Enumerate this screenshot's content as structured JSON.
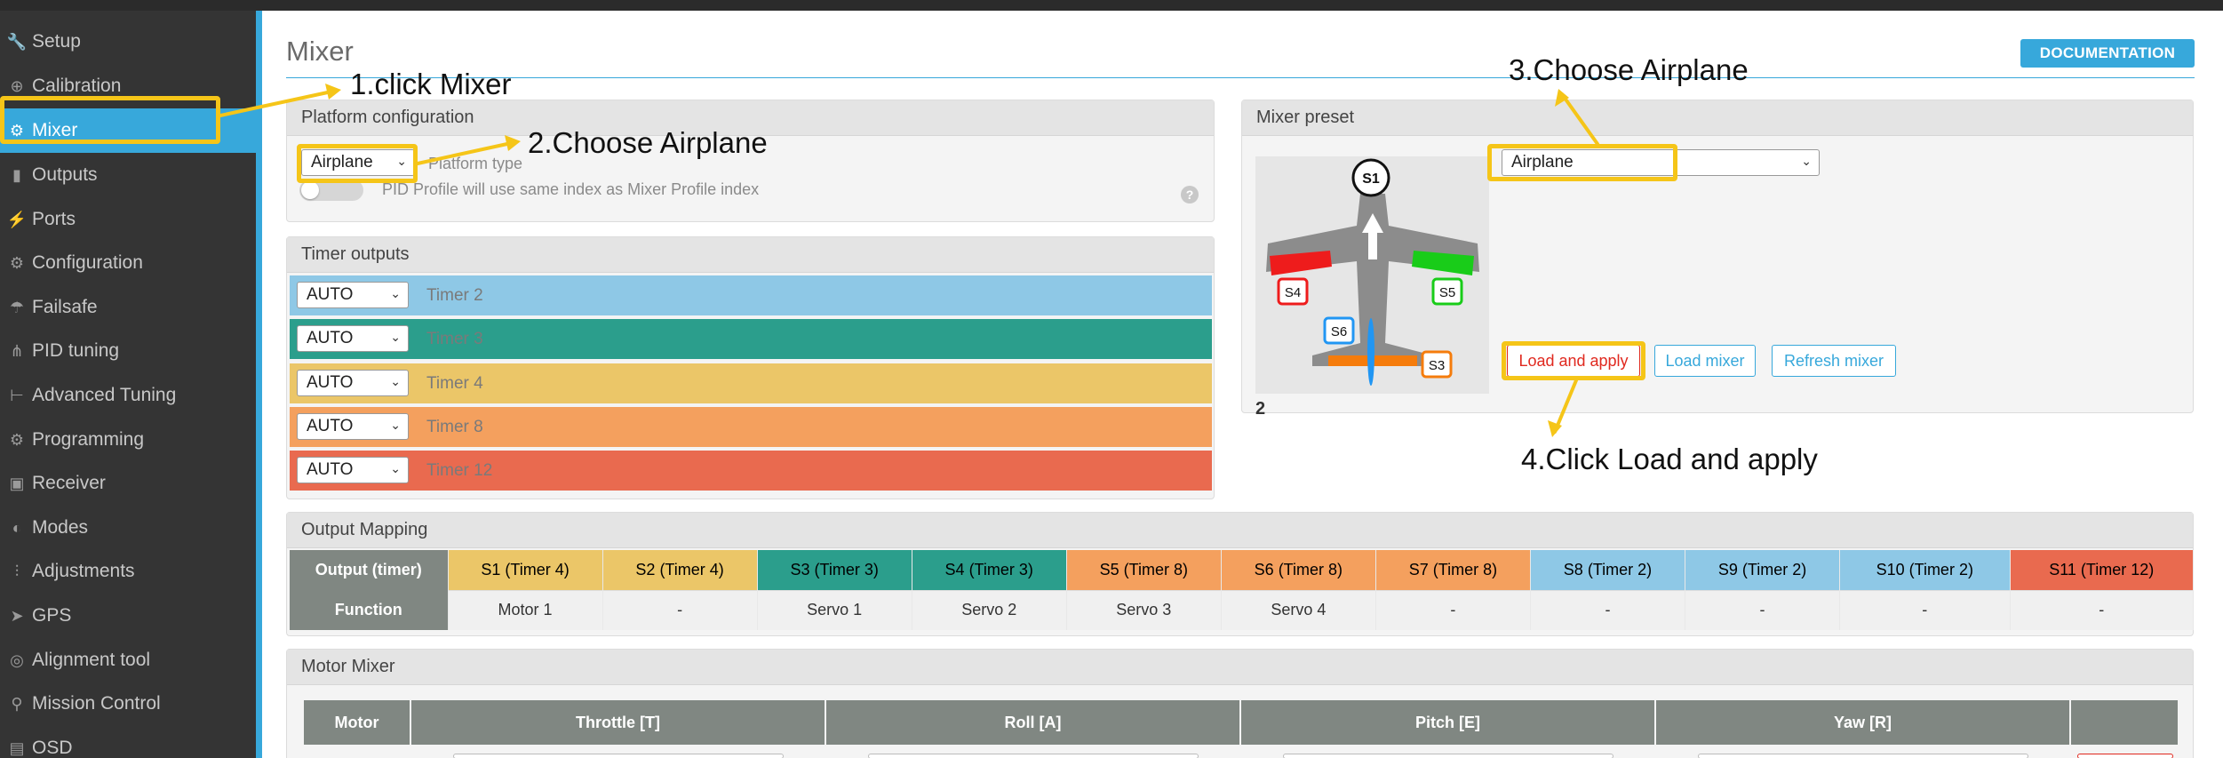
{
  "sidebar": {
    "items": [
      {
        "label": "Setup",
        "icon": "wrench-icon"
      },
      {
        "label": "Calibration",
        "icon": "crosshair-icon"
      },
      {
        "label": "Mixer",
        "icon": "mixer-icon"
      },
      {
        "label": "Outputs",
        "icon": "motor-icon"
      },
      {
        "label": "Ports",
        "icon": "plug-icon"
      },
      {
        "label": "Configuration",
        "icon": "gear-icon"
      },
      {
        "label": "Failsafe",
        "icon": "parachute-icon"
      },
      {
        "label": "PID tuning",
        "icon": "pid-icon"
      },
      {
        "label": "Advanced Tuning",
        "icon": "tuning-icon"
      },
      {
        "label": "Programming",
        "icon": "gear-icon"
      },
      {
        "label": "Receiver",
        "icon": "receiver-icon"
      },
      {
        "label": "Modes",
        "icon": "modes-icon"
      },
      {
        "label": "Adjustments",
        "icon": "sliders-icon"
      },
      {
        "label": "GPS",
        "icon": "gps-icon"
      },
      {
        "label": "Alignment tool",
        "icon": "compass-icon"
      },
      {
        "label": "Mission Control",
        "icon": "map-pin-icon"
      },
      {
        "label": "OSD",
        "icon": "osd-icon"
      }
    ],
    "active": "Mixer"
  },
  "header": {
    "title": "Mixer",
    "documentation": "DOCUMENTATION"
  },
  "platform": {
    "title": "Platform configuration",
    "type_value": "Airplane",
    "type_label": "Platform type",
    "pid_profile_text": "PID Profile will use same index as Mixer Profile index",
    "help": "?"
  },
  "timers": {
    "title": "Timer outputs",
    "rows": [
      {
        "mode": "AUTO",
        "label": "Timer 2",
        "color": "#8ec8e6"
      },
      {
        "mode": "AUTO",
        "label": "Timer 3",
        "color": "#2b9e8c"
      },
      {
        "mode": "AUTO",
        "label": "Timer 4",
        "color": "#ebc668"
      },
      {
        "mode": "AUTO",
        "label": "Timer 8",
        "color": "#f4a05e"
      },
      {
        "mode": "AUTO",
        "label": "Timer 12",
        "color": "#e96a4f"
      }
    ]
  },
  "preset": {
    "title": "Mixer preset",
    "value": "Airplane",
    "load_apply": "Load and apply",
    "load_mixer": "Load mixer",
    "refresh_mixer": "Refresh mixer",
    "servo_labels": {
      "s1": "S1",
      "s3": "S3",
      "s4": "S4",
      "s5": "S5",
      "s6": "S6"
    },
    "stray_glyph": "2"
  },
  "output_mapping": {
    "title": "Output Mapping",
    "row_output_label": "Output (timer)",
    "row_function_label": "Function",
    "columns": [
      {
        "output": "S1 (Timer 4)",
        "function": "Motor 1",
        "color": "#ebc668"
      },
      {
        "output": "S2 (Timer 4)",
        "function": "-",
        "color": "#ebc668"
      },
      {
        "output": "S3 (Timer 3)",
        "function": "Servo 1",
        "color": "#2b9e8c"
      },
      {
        "output": "S4 (Timer 3)",
        "function": "Servo 2",
        "color": "#2b9e8c"
      },
      {
        "output": "S5 (Timer 8)",
        "function": "Servo 3",
        "color": "#f4a05e"
      },
      {
        "output": "S6 (Timer 8)",
        "function": "Servo 4",
        "color": "#f4a05e"
      },
      {
        "output": "S7 (Timer 8)",
        "function": "-",
        "color": "#f4a05e"
      },
      {
        "output": "S8 (Timer 2)",
        "function": "-",
        "color": "#8ec8e6"
      },
      {
        "output": "S9 (Timer 2)",
        "function": "-",
        "color": "#8ec8e6"
      },
      {
        "output": "S10 (Timer 2)",
        "function": "-",
        "color": "#8ec8e6"
      },
      {
        "output": "S11 (Timer 12)",
        "function": "-",
        "color": "#e96a4f"
      }
    ]
  },
  "motor_mixer": {
    "title": "Motor Mixer",
    "headers": {
      "motor": "Motor",
      "throttle": "Throttle [T]",
      "roll": "Roll [A]",
      "pitch": "Pitch [E]",
      "yaw": "Yaw [R]"
    }
  },
  "annotations": {
    "step1": "1.click Mixer",
    "step2": "2.Choose Airplane",
    "step3": "3.Choose Airplane",
    "step4": "4.Click Load and apply",
    "accent": "#f5c518"
  }
}
